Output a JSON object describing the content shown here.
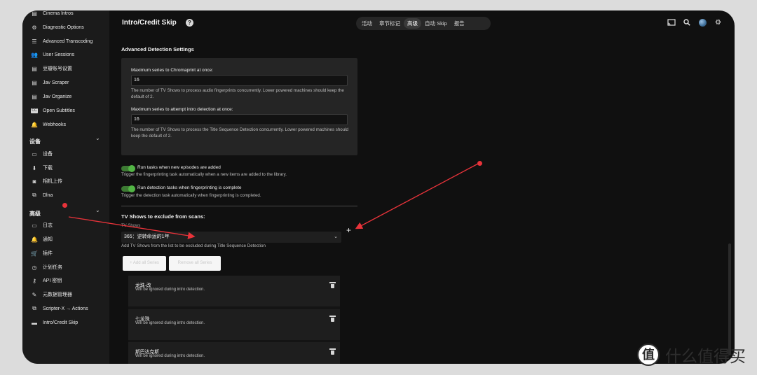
{
  "sidebar": {
    "items_top": [
      {
        "label": "Cinema Intros",
        "icon": "film-icon"
      },
      {
        "label": "Diagnostic Options",
        "icon": "gear-icon"
      },
      {
        "label": "Advanced Transcoding",
        "icon": "sliders-icon"
      },
      {
        "label": "User Sessions",
        "icon": "users-icon"
      },
      {
        "label": "豆瓣账号设置",
        "icon": "film-icon"
      },
      {
        "label": "Jav Scraper",
        "icon": "film-icon"
      },
      {
        "label": "Jav Organize",
        "icon": "film-icon"
      },
      {
        "label": "Open Subtitles",
        "icon": "cc-icon"
      },
      {
        "label": "Webhooks",
        "icon": "bell-icon"
      }
    ],
    "section_devices": "设备",
    "items_devices": [
      {
        "label": "设备",
        "icon": "devices-icon"
      },
      {
        "label": "下载",
        "icon": "download-icon"
      },
      {
        "label": "相机上传",
        "icon": "camera-icon"
      },
      {
        "label": "Dlna",
        "icon": "dlna-icon"
      }
    ],
    "section_advanced": "高级",
    "items_advanced": [
      {
        "label": "日志",
        "icon": "folder-icon"
      },
      {
        "label": "通知",
        "icon": "bell-icon"
      },
      {
        "label": "插件",
        "icon": "cart-icon"
      },
      {
        "label": "计划任务",
        "icon": "clock-icon"
      },
      {
        "label": "API 密钥",
        "icon": "key-icon"
      },
      {
        "label": "元数据管理器",
        "icon": "pencil-icon"
      },
      {
        "label": "Scripter-X → Actions",
        "icon": "copy-icon"
      },
      {
        "label": "Intro/Credit Skip",
        "icon": "folder-icon"
      }
    ]
  },
  "header": {
    "title": "Intro/Credit Skip",
    "tabs": [
      "活动",
      "章节标记",
      "高级",
      "自动 Skip",
      "报告"
    ],
    "active_tab": "高级"
  },
  "advanced_detection": {
    "title": "Advanced Detection Settings",
    "chromaprint_label": "Maximum series to Chromaprint at once:",
    "chromaprint_value": "16",
    "chromaprint_help": "The number of TV Shows to process audio fingerprints concurrently. Lower powered machines should keep the default of 2.",
    "intro_label": "Maximum series to attempt intro detection at once:",
    "intro_value": "16",
    "intro_help": "The number of TV Shows to process the Title Sequence Detection concurrently. Lower powered machines should keep the default of 2."
  },
  "toggles": {
    "run_new_label": "Run tasks when new episodes are added",
    "run_new_help": "Trigger the fingerprinting task automatically when a new items are added to the library.",
    "run_detect_label": "Run detection tasks when fingerprinting is complete",
    "run_detect_help": "Trigger the detection task automatically when fingerprinting is completed."
  },
  "exclude": {
    "title": "TV Shows to exclude from scans:",
    "select_label": "TV Shows",
    "select_value": "365：逆转命运的1年",
    "help": "Add TV Shows from the list to be excluded during Title Sequence Detection",
    "btn_add_all": "+ Add all Series",
    "btn_remove_all": "Remove all Series",
    "items": [
      {
        "title": "龙珠-改",
        "subtitle": "Will be ignored during intro detection."
      },
      {
        "title": "七龙珠",
        "subtitle": "Will be ignored during intro detection."
      },
      {
        "title": "斯巴达克斯",
        "subtitle": "Will be ignored during intro detection."
      }
    ]
  },
  "annotation_color": "#e8333a",
  "watermark": {
    "logo": "值",
    "text": "什么值得买"
  }
}
